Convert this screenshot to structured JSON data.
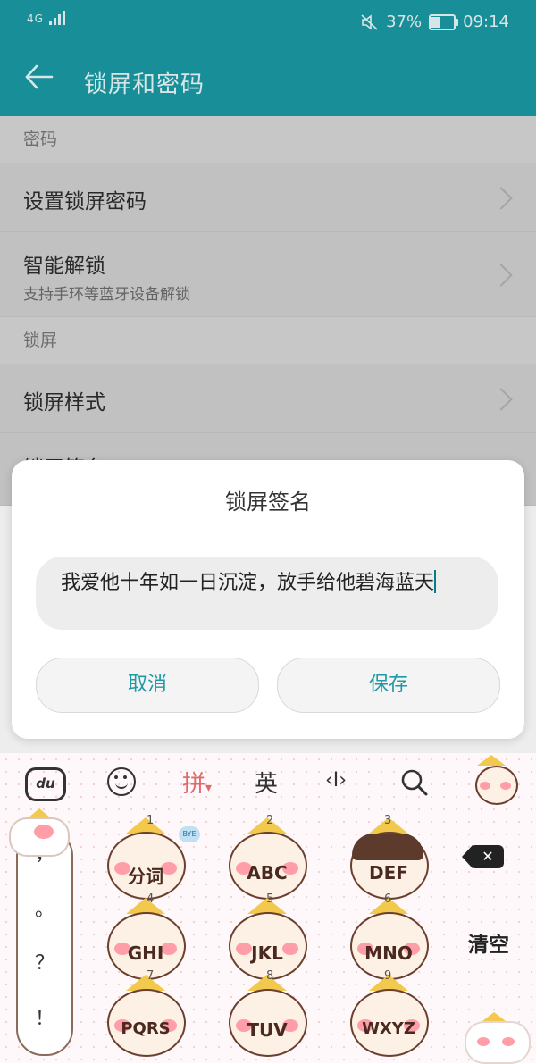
{
  "status_bar": {
    "network": "4G",
    "battery_percent": "37%",
    "battery_level": 0.37,
    "time": "09:14"
  },
  "app_bar": {
    "title": "锁屏和密码"
  },
  "settings": {
    "sections": [
      {
        "header": "密码",
        "items": [
          {
            "label": "设置锁屏密码",
            "subtitle": ""
          },
          {
            "label": "智能解锁",
            "subtitle": "支持手环等蓝牙设备解锁"
          }
        ]
      },
      {
        "header": "锁屏",
        "items": [
          {
            "label": "锁屏样式",
            "subtitle": ""
          },
          {
            "label": "锁屏签名",
            "subtitle": ""
          }
        ]
      }
    ]
  },
  "dialog": {
    "title": "锁屏签名",
    "input_value": "我爱他十年如一日沉淀，放手给他碧海蓝天",
    "cancel_label": "取消",
    "save_label": "保存"
  },
  "keyboard": {
    "toolbar": {
      "du_label": "du",
      "pinyin_label": "拼",
      "english_label": "英",
      "cursor_label": "‹I›"
    },
    "keys": [
      {
        "num": "1",
        "label": "分词"
      },
      {
        "num": "2",
        "label": "ABC"
      },
      {
        "num": "3",
        "label": "DEF"
      },
      {
        "num": "4",
        "label": "GHI"
      },
      {
        "num": "5",
        "label": "JKL"
      },
      {
        "num": "6",
        "label": "MNO"
      },
      {
        "num": "7",
        "label": "PQRS"
      },
      {
        "num": "8",
        "label": "TUV"
      },
      {
        "num": "9",
        "label": "WXYZ"
      }
    ],
    "punctuation": [
      "，",
      "。",
      "？",
      "！"
    ],
    "clear_label": "清空",
    "bubble_label": "BYE"
  }
}
